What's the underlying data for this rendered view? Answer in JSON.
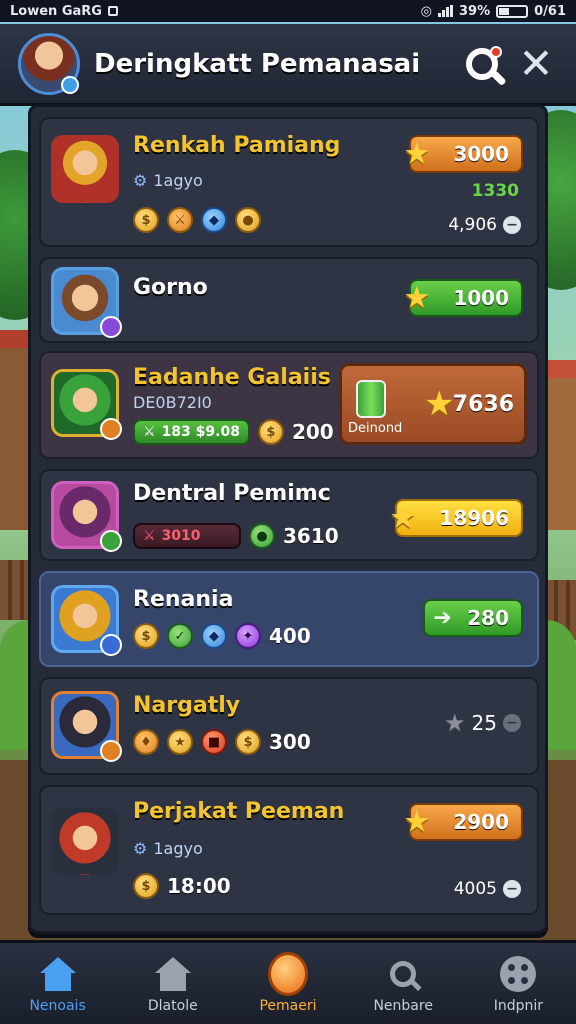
{
  "status_bar": {
    "left_text": "Lowen GaRG",
    "battery": "39%",
    "time": "0/61"
  },
  "header": {
    "title": "Deringkatt Pemanasai",
    "avatar_icon": "hero-avatar-icon",
    "search_icon": "search-icon",
    "close_icon": "close-icon"
  },
  "rows": [
    {
      "name": "Renkah Pamiang",
      "sub": "1agyo",
      "price": "3000",
      "secondary": "1330",
      "count": "4,906"
    },
    {
      "name": "Gorno",
      "price": "1000"
    },
    {
      "name": "Eadanhe Galaiis",
      "sub": "DE0B72I0",
      "pill": "183 $9.08",
      "value": "200",
      "featured_value": "7636",
      "featured_label": "Deinond"
    },
    {
      "name": "Dentral Pemimc",
      "pill": "3010",
      "value": "3610",
      "price": "18906"
    },
    {
      "name": "Renania",
      "value": "400",
      "price": "280"
    },
    {
      "name": "Nargatly",
      "value": "300",
      "count": "25"
    },
    {
      "name": "Perjakat Peeman",
      "sub": "1agyo",
      "value": "18:00",
      "price": "2900",
      "count": "4005"
    }
  ],
  "nav": [
    {
      "label": "Nenoais",
      "icon": "home-icon"
    },
    {
      "label": "Dlatole",
      "icon": "house-icon"
    },
    {
      "label": "Pemaeri",
      "icon": "orb-icon"
    },
    {
      "label": "Nenbare",
      "icon": "search-icon"
    },
    {
      "label": "Indpnir",
      "icon": "menu-icon"
    }
  ],
  "colors": {
    "accent_gold": "#f4c430",
    "accent_blue": "#4aa0f0",
    "panel": "#252b38"
  }
}
